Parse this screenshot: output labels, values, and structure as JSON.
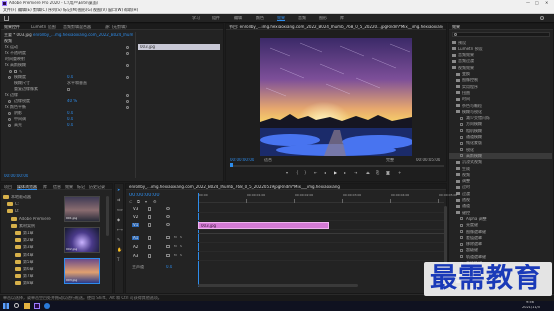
{
  "titlebar": {
    "app_title": "Adobe Premiere Pro 2020 - C:\\用户\\Elite\\桌面\\",
    "window_controls": [
      "—",
      "□",
      "✕"
    ]
  },
  "menubar": {
    "items": [
      "文件(F)",
      "编辑(E)",
      "剪辑(C)",
      "序列(S)",
      "标记(M)",
      "图形(G)",
      "视图(V)",
      "窗口(W)",
      "帮助(H)"
    ]
  },
  "workspaces": {
    "items": [
      "学习",
      "组件",
      "编辑",
      "颜色",
      "效果",
      "音频",
      "图形",
      "库"
    ],
    "active_index": 4
  },
  "effect_controls": {
    "tabs": [
      "效果控件",
      "Lumetri 范围",
      "音频剪辑混合器",
      "源: (无剪辑)"
    ],
    "clip_label": "主要 * 003.jpg",
    "seq_label": "enrollby_...mg.hexiaoxiang.com_2022_B024_Ihumb_768_0_5...",
    "mini_clip": "003.jpg",
    "section_video": "视频",
    "rows": [
      {
        "label": "fx 运动",
        "value": ""
      },
      {
        "label": "fx 不透明度",
        "value": ""
      },
      {
        "label": "时间重映射",
        "value": ""
      },
      {
        "label": "fx 高斯模糊",
        "value": ""
      },
      {
        "label": "模糊度",
        "value": "0.0"
      },
      {
        "label": "模糊尺寸",
        "value": "水平和垂直"
      },
      {
        "label": "重复边缘像素",
        "value": ""
      },
      {
        "label": "fx 边缘",
        "value": ""
      },
      {
        "label": "边缘锐度",
        "value": "40 %"
      },
      {
        "label": "fx 颜色平衡",
        "value": ""
      },
      {
        "label": "阴影",
        "value": "0.0"
      },
      {
        "label": "中间调",
        "value": "0.0"
      },
      {
        "label": "高光",
        "value": "0.0"
      }
    ],
    "timecode": "00:00:00:00"
  },
  "program": {
    "tab_title": "节目: enrollby_...img.hexiaoxiang.com_2022_B024_Ihumb_768_0_5_20220...jpgRndm*Mix__img.hexiaoxiang",
    "timecode_left": "00:00:00:00",
    "fit_label": "适合",
    "quality_label": "完整",
    "timecode_right": "00:00:05:00"
  },
  "project": {
    "tabs": [
      "项目",
      "媒体浏览器",
      "库",
      "信息",
      "效果",
      "标记",
      "历史记录"
    ],
    "active_tab_index": 1,
    "tree": [
      {
        "label": "本地驱动器",
        "indent": 0
      },
      {
        "label": "C:",
        "indent": 1
      },
      {
        "label": "D:",
        "indent": 1
      },
      {
        "label": "Adobe Premiere",
        "indent": 2
      },
      {
        "label": "素材案例",
        "indent": 2
      },
      {
        "label": "第1章",
        "indent": 3
      },
      {
        "label": "第2章",
        "indent": 3
      },
      {
        "label": "第3章",
        "indent": 3
      },
      {
        "label": "第4章",
        "indent": 3
      },
      {
        "label": "第5章",
        "indent": 3
      },
      {
        "label": "第6章",
        "indent": 3
      },
      {
        "label": "第7章",
        "indent": 3
      },
      {
        "label": "第8章",
        "indent": 3
      }
    ],
    "thumb_captions": [
      "001.jpg",
      "002.jpg",
      "003.jpg"
    ]
  },
  "timeline": {
    "tab_title": "enrollby_...img.hexiaoxiang.com_2022_B024_Ihumb_768_0_5_20220519jpgRndm*Mix___img.hexiaoxiang",
    "timecode": "00:00:00:00",
    "ruler_ticks": [
      "00:00",
      "00:00:01:00",
      "00:00:02:00",
      "00:00:03:00",
      "00:00:04:00",
      "00:00:05:00"
    ],
    "video_tracks": [
      "V3",
      "V2",
      "V1"
    ],
    "audio_tracks": [
      "A1",
      "A2",
      "A3"
    ],
    "master_label": "主声道",
    "master_value": "0.0",
    "clip_label": "003.jpg"
  },
  "effects": {
    "tab": "效果",
    "items": [
      {
        "label": "预设",
        "indent": 0
      },
      {
        "label": "Lumetri 预设",
        "indent": 0
      },
      {
        "label": "音频效果",
        "indent": 0
      },
      {
        "label": "音频过渡",
        "indent": 0
      },
      {
        "label": "视频效果",
        "indent": 0
      },
      {
        "label": "变换",
        "indent": 1
      },
      {
        "label": "图像控制",
        "indent": 1
      },
      {
        "label": "实用程序",
        "indent": 1
      },
      {
        "label": "扭曲",
        "indent": 1
      },
      {
        "label": "时间",
        "indent": 1
      },
      {
        "label": "杂色与颗粒",
        "indent": 1
      },
      {
        "label": "模糊与锐化",
        "indent": 1
      },
      {
        "label": "减少交错闪烁",
        "indent": 2
      },
      {
        "label": "方向模糊",
        "indent": 2
      },
      {
        "label": "相机模糊",
        "indent": 2
      },
      {
        "label": "通道模糊",
        "indent": 2
      },
      {
        "label": "钝化蒙版",
        "indent": 2
      },
      {
        "label": "锐化",
        "indent": 2
      },
      {
        "label": "高斯模糊",
        "indent": 2
      },
      {
        "label": "沉浸式视频",
        "indent": 1
      },
      {
        "label": "生成",
        "indent": 1
      },
      {
        "label": "视频",
        "indent": 1
      },
      {
        "label": "调整",
        "indent": 1
      },
      {
        "label": "过时",
        "indent": 1
      },
      {
        "label": "过渡",
        "indent": 1
      },
      {
        "label": "透视",
        "indent": 1
      },
      {
        "label": "通道",
        "indent": 1
      },
      {
        "label": "键控",
        "indent": 1
      },
      {
        "label": "Alpha 调整",
        "indent": 2
      },
      {
        "label": "亮度键",
        "indent": 2
      },
      {
        "label": "图像遮罩键",
        "indent": 2
      },
      {
        "label": "差值遮罩",
        "indent": 2
      },
      {
        "label": "移除遮罩",
        "indent": 2
      },
      {
        "label": "超级键",
        "indent": 2
      },
      {
        "label": "轨道遮罩键",
        "indent": 2
      },
      {
        "label": "非红色键",
        "indent": 2
      },
      {
        "label": "颜色键",
        "indent": 2
      },
      {
        "label": "颜色校正",
        "indent": 1
      },
      {
        "label": "风格化",
        "indent": 1
      },
      {
        "label": "视频过渡",
        "indent": 0
      }
    ],
    "selected_index": 18
  },
  "statusbar": {
    "text": "单击以选择，或单击空白处并拖动以进行框选。使用 Shift、Alt 和 Ctrl 可获得其他选项。"
  },
  "taskbar": {
    "time": "9:56",
    "date": "2021/11/5"
  },
  "watermark": {
    "text": "最需教育"
  }
}
